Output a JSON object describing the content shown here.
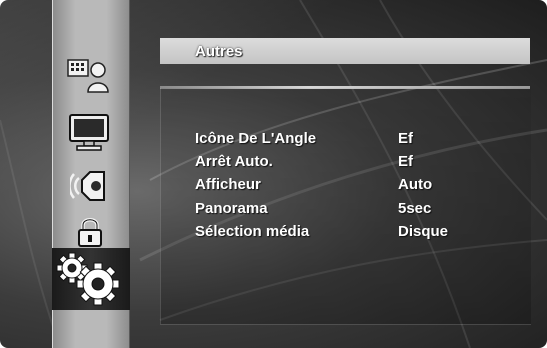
{
  "menu": {
    "title": "Autres",
    "sidebar_icons": [
      "language-icon",
      "display-icon",
      "audio-icon",
      "lock-icon",
      "settings-gears-icon"
    ],
    "active_icon": "settings-gears-icon",
    "rows": [
      {
        "label": "Icône De L'Angle",
        "value": "Ef"
      },
      {
        "label": "Arrêt Auto.",
        "value": "Ef"
      },
      {
        "label": "Afficheur",
        "value": "Auto"
      },
      {
        "label": "Panorama",
        "value": "5sec"
      },
      {
        "label": "Sélection média",
        "value": "Disque"
      }
    ]
  },
  "colors": {
    "background": "#3c3c3c",
    "sidebar": "#b9b9b9",
    "header_bar": "#d0d0d0",
    "text": "#ffffff"
  }
}
